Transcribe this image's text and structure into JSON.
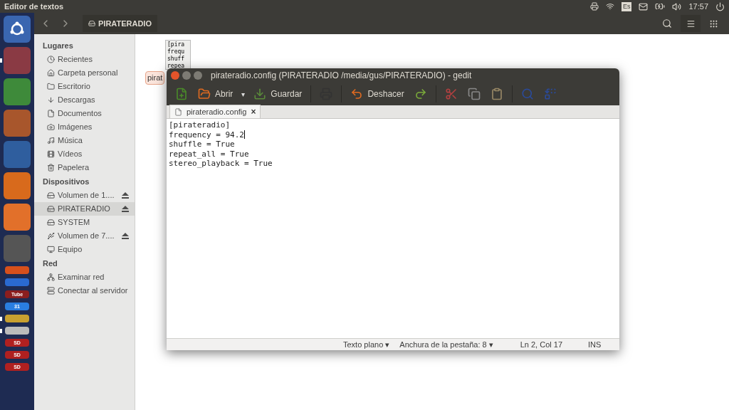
{
  "top_bar": {
    "title": "Editor de textos",
    "keyboard_layout": "Es",
    "time": "17:57"
  },
  "launcher": [
    {
      "kind": "ubuntu",
      "color": "#3a66b0",
      "running": false
    },
    {
      "kind": "files",
      "color": "#8a3a44",
      "running": true
    },
    {
      "kind": "calc",
      "color": "#3e8a3a",
      "running": false
    },
    {
      "kind": "impress",
      "color": "#a8562c",
      "running": false
    },
    {
      "kind": "writer",
      "color": "#2f5e9e",
      "running": false
    },
    {
      "kind": "firefox",
      "color": "#d86a1c",
      "running": false
    },
    {
      "kind": "software",
      "color": "#e2702a",
      "running": false
    },
    {
      "kind": "settings",
      "color": "#555555",
      "running": false
    },
    {
      "kind": "stack",
      "color": "#d6501c",
      "running": false
    },
    {
      "kind": "stack",
      "color": "#2a6ad0",
      "running": false
    },
    {
      "kind": "stack",
      "color": "#8b1e1e",
      "label": "Tube",
      "running": false
    },
    {
      "kind": "stack",
      "color": "#2a7ee0",
      "label": "31",
      "running": false
    },
    {
      "kind": "stack",
      "color": "#c8a030",
      "running": true
    },
    {
      "kind": "stack",
      "color": "#bbbbbb",
      "running": true
    },
    {
      "kind": "stack",
      "color": "#b02020",
      "label": "SD",
      "running": false
    },
    {
      "kind": "stack",
      "color": "#b02020",
      "label": "SD",
      "running": false
    },
    {
      "kind": "stack",
      "color": "#b02020",
      "label": "SD",
      "running": false
    }
  ],
  "files": {
    "location": "PIRATERADIO",
    "sidebar": [
      {
        "heading": "Lugares",
        "items": [
          {
            "label": "Recientes",
            "ejectable": false,
            "selected": false
          },
          {
            "label": "Carpeta personal",
            "ejectable": false,
            "selected": false
          },
          {
            "label": "Escritorio",
            "ejectable": false,
            "selected": false
          },
          {
            "label": "Descargas",
            "ejectable": false,
            "selected": false
          },
          {
            "label": "Documentos",
            "ejectable": false,
            "selected": false
          },
          {
            "label": "Imágenes",
            "ejectable": false,
            "selected": false
          },
          {
            "label": "Música",
            "ejectable": false,
            "selected": false
          },
          {
            "label": "Vídeos",
            "ejectable": false,
            "selected": false
          },
          {
            "label": "Papelera",
            "ejectable": false,
            "selected": false
          }
        ]
      },
      {
        "heading": "Dispositivos",
        "items": [
          {
            "label": "Volumen de 1....",
            "ejectable": true,
            "selected": false
          },
          {
            "label": "PIRATERADIO",
            "ejectable": true,
            "selected": true
          },
          {
            "label": "SYSTEM",
            "ejectable": false,
            "selected": false
          },
          {
            "label": "Volumen de 7....",
            "ejectable": true,
            "selected": false
          },
          {
            "label": "Equipo",
            "ejectable": false,
            "selected": false
          }
        ]
      },
      {
        "heading": "Red",
        "items": [
          {
            "label": "Examinar red",
            "ejectable": false,
            "selected": false
          },
          {
            "label": "Conectar al servidor",
            "ejectable": false,
            "selected": false
          }
        ]
      }
    ],
    "file": {
      "thumbnail_lines": [
        "[pira",
        "frequ",
        "shuff",
        "repea"
      ],
      "name": "pirat",
      "selected": true
    }
  },
  "editor": {
    "title": "pirateradio.config (PIRATERADIO /media/gus/PIRATERADIO) - gedit",
    "toolbar": [
      {
        "kind": "new"
      },
      {
        "kind": "open",
        "label": "Abrir"
      },
      {
        "kind": "dropdown",
        "label": "▾"
      },
      {
        "kind": "save",
        "label": "Guardar"
      },
      {
        "kind": "separator"
      },
      {
        "kind": "print"
      },
      {
        "kind": "separator"
      },
      {
        "kind": "undo",
        "label": "Deshacer"
      },
      {
        "kind": "redo"
      },
      {
        "kind": "separator"
      },
      {
        "kind": "cut"
      },
      {
        "kind": "copy"
      },
      {
        "kind": "paste"
      },
      {
        "kind": "separator"
      },
      {
        "kind": "find"
      },
      {
        "kind": "replace"
      }
    ],
    "tabs": [
      {
        "label": "pirateradio.config",
        "close": "×",
        "selected": true
      }
    ],
    "lines": [
      {
        "text": "[pirateradio]",
        "cursor": false
      },
      {
        "text": "frequency = 94.2",
        "cursor": true
      },
      {
        "text": "shuffle = True",
        "cursor": false
      },
      {
        "text": "repeat_all = True",
        "cursor": false
      },
      {
        "text": "stereo_playback = True",
        "cursor": false
      }
    ],
    "status": {
      "language": "Texto plano",
      "language_arrow": "▾",
      "tab_width": "Anchura de la pestaña: 8",
      "tab_width_arrow": "▾",
      "position": "Ln 2, Col 17",
      "mode": "INS"
    }
  }
}
